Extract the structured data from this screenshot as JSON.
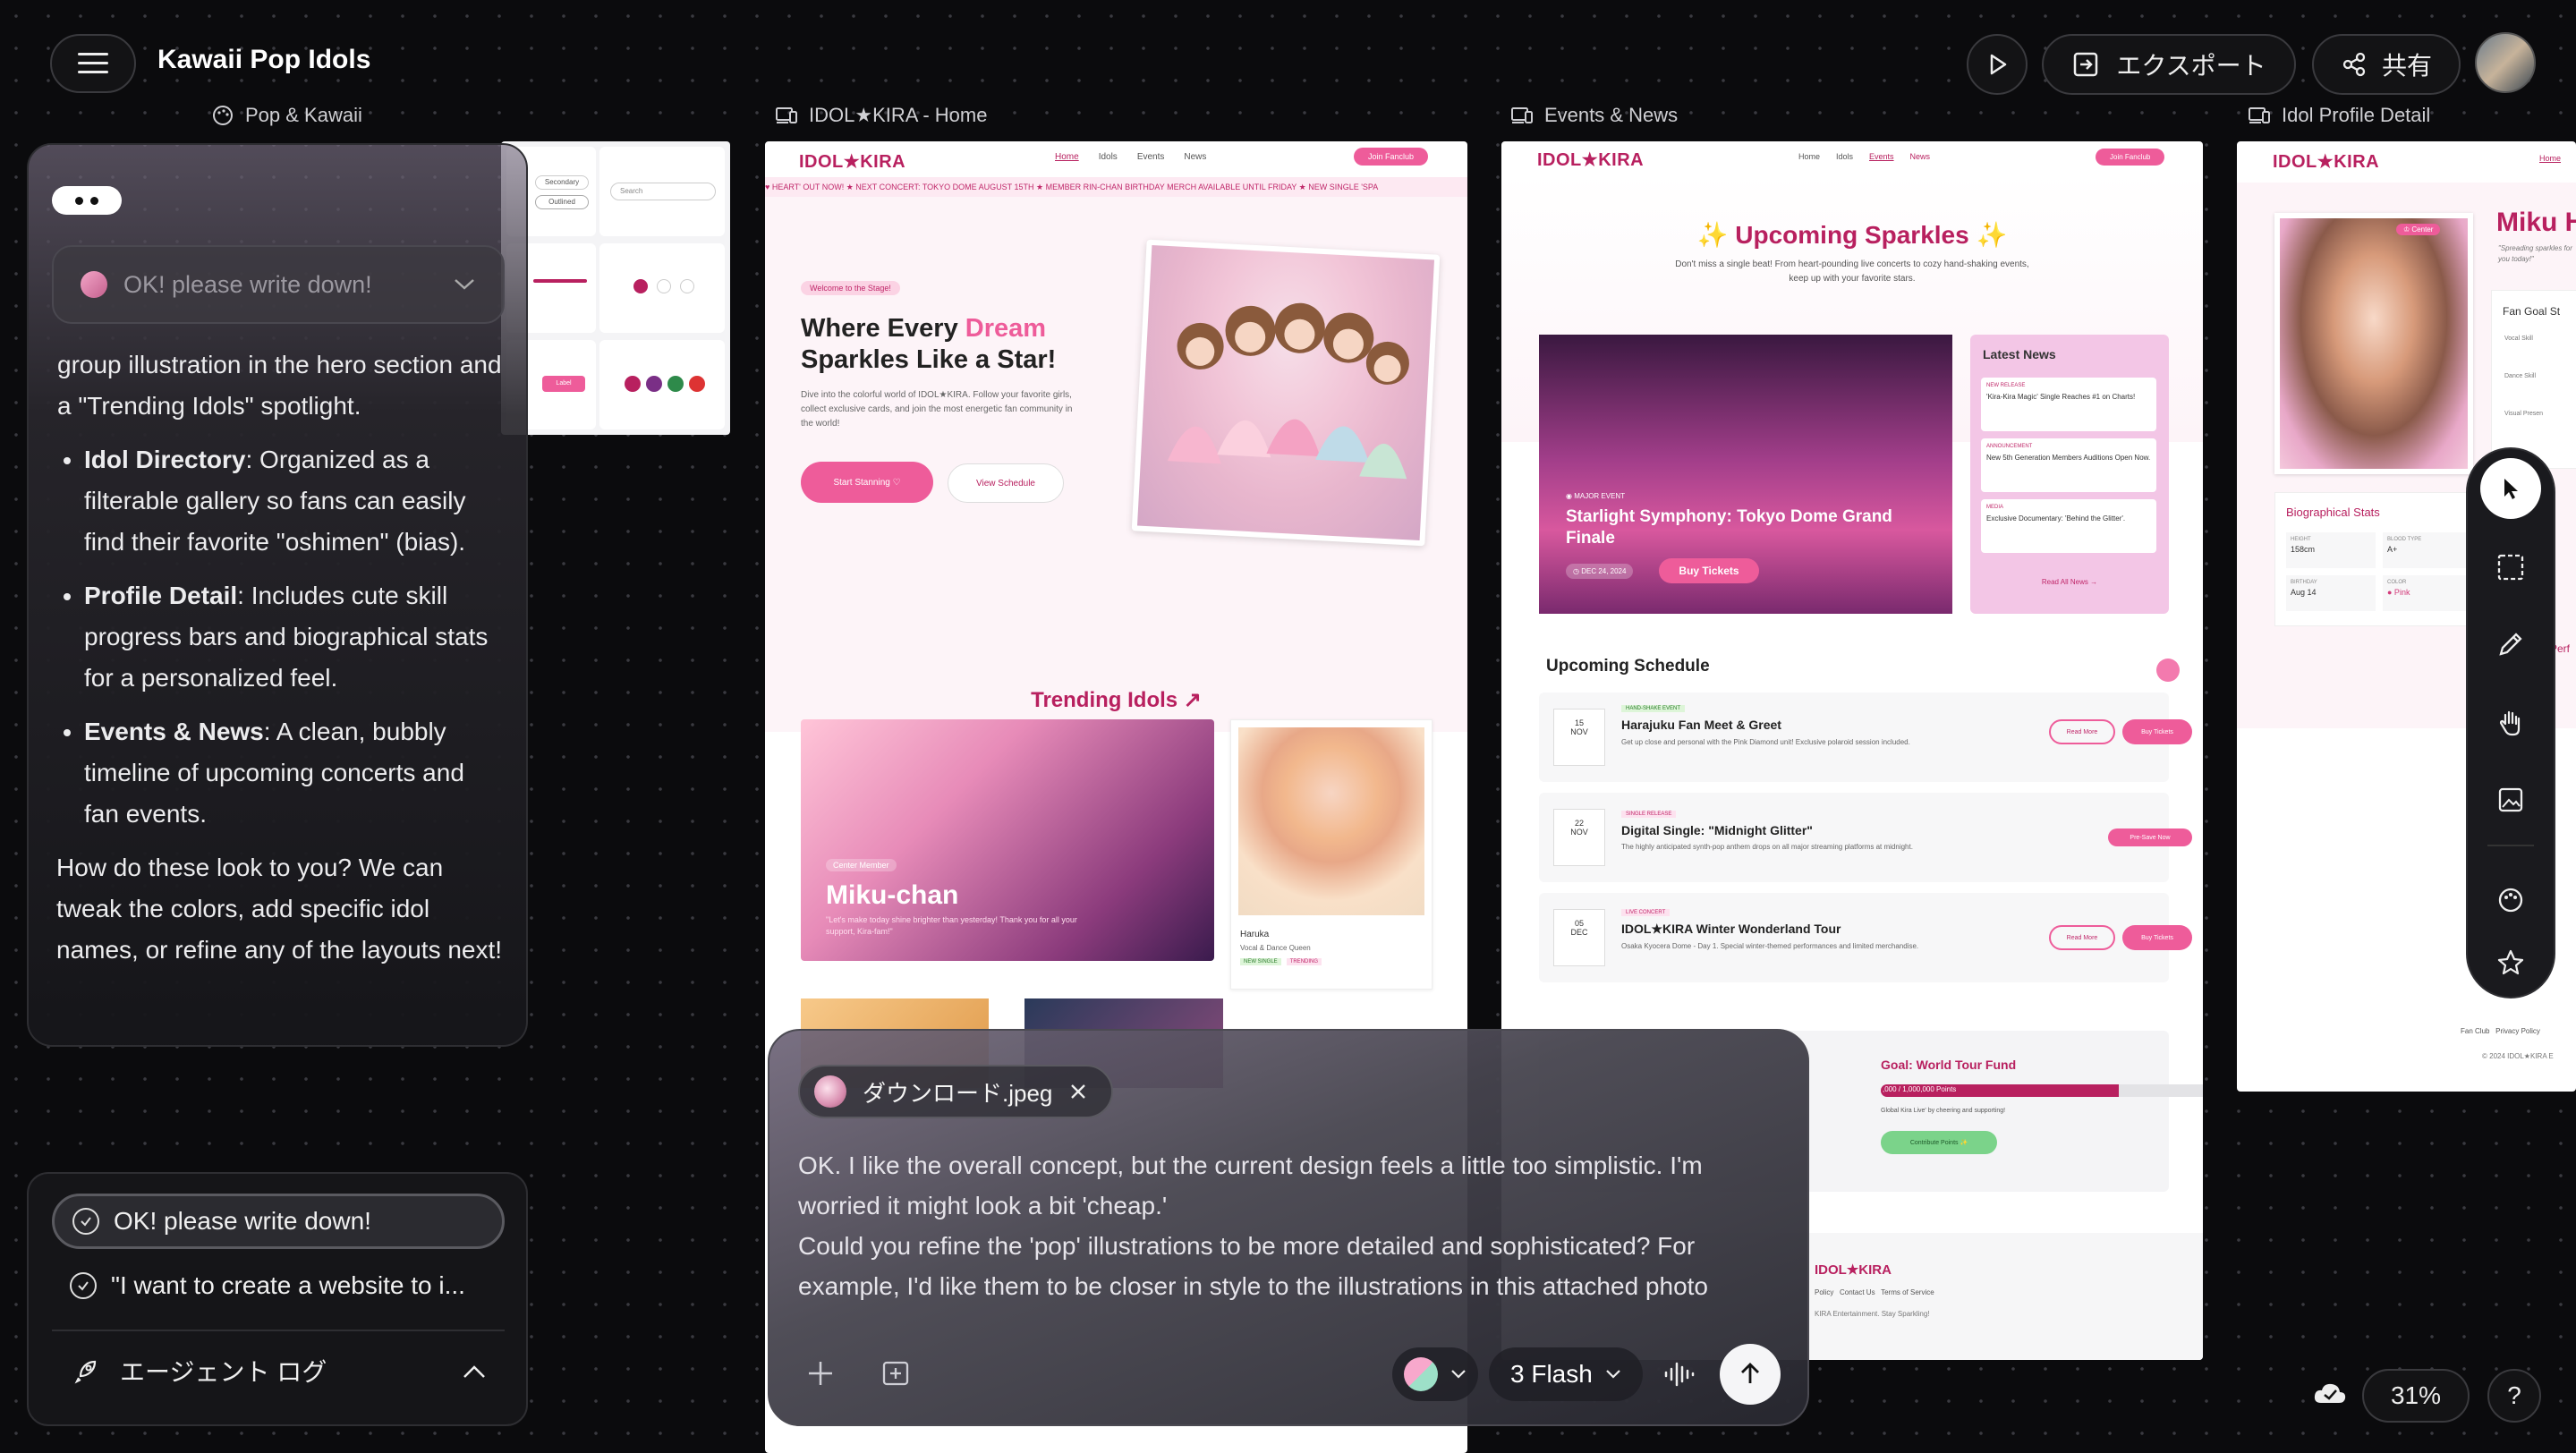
{
  "app": {
    "title": "Kawaii Pop Idols"
  },
  "topbar": {
    "export_label": "エクスポート",
    "share_label": "共有"
  },
  "frames": [
    {
      "label": "Pop & Kawaii"
    },
    {
      "label": "IDOL★KIRA - Home"
    },
    {
      "label": "Events & News"
    },
    {
      "label": "Idol Profile Detail"
    }
  ],
  "style_frame": {
    "secondary": "Secondary",
    "outlined": "Outlined",
    "search": "Search",
    "label": "Label"
  },
  "home": {
    "logo": "IDOL★KIRA",
    "nav": [
      "Home",
      "Idols",
      "Events",
      "News"
    ],
    "join": "Join Fanclub",
    "ticker": "♥ HEART' OUT NOW! ★ NEXT CONCERT: TOKYO DOME AUGUST 15TH ★ MEMBER RIN-CHAN BIRTHDAY MERCH AVAILABLE UNTIL FRIDAY ★ NEW SINGLE 'SPA",
    "welcome_badge": "Welcome to the Stage!",
    "hero_title_1": "Where Every ",
    "hero_title_em": "Dream",
    "hero_title_2": "Sparkles Like a Star!",
    "hero_desc": "Dive into the colorful world of IDOL★KIRA. Follow your favorite girls, collect exclusive cards, and join the most energetic fan community in the world!",
    "start_btn": "Start Stanning ♡",
    "schedule_btn": "View Schedule",
    "trending_title": "Trending Idols ↗",
    "card1_badge": "Center Member",
    "card1_name": "Miku-chan",
    "card1_quote": "\"Let's make today shine brighter than yesterday! Thank you for all your support, Kira-fam!\"",
    "card2_name": "Haruka",
    "card2_role": "Vocal & Dance Queen",
    "card2_tags": [
      "NEW SINGLE",
      "TRENDING"
    ]
  },
  "events": {
    "logo": "IDOL★KIRA",
    "nav": [
      "Home",
      "Idols",
      "Events",
      "News"
    ],
    "join": "Join Fanclub",
    "title": "✨ Upcoming Sparkles ✨",
    "subtitle": "Don't miss a single beat! From heart-pounding live concerts to cozy hand-shaking events, keep up with your favorite stars.",
    "major_tag": "◉ MAJOR EVENT",
    "major_title": "Starlight Symphony: Tokyo Dome Grand Finale",
    "major_date": "◷ DEC 24, 2024",
    "buy_tickets": "Buy Tickets",
    "latest_news": "Latest News",
    "news": [
      {
        "tag": "NEW RELEASE",
        "text": "'Kira-Kira Magic' Single Reaches #1 on Charts!"
      },
      {
        "tag": "ANNOUNCEMENT",
        "text": "New 5th Generation Members Auditions Open Now."
      },
      {
        "tag": "MEDIA",
        "text": "Exclusive Documentary: 'Behind the Glitter'."
      }
    ],
    "read_all": "Read All News →",
    "schedule_title": "Upcoming Schedule",
    "schedule": [
      {
        "day": "15",
        "month": "NOV",
        "tag": "HAND-SHAKE EVENT",
        "title": "Harajuku Fan Meet & Greet",
        "desc": "Get up close and personal with the Pink Diamond unit! Exclusive polaroid session included.",
        "btn1": "Read More",
        "btn2": "Buy Tickets"
      },
      {
        "day": "22",
        "month": "NOV",
        "tag": "SINGLE RELEASE",
        "title": "Digital Single: \"Midnight Glitter\"",
        "desc": "The highly anticipated synth-pop anthem drops on all major streaming platforms at midnight.",
        "btn1": "",
        "btn2": "Pre-Save Now"
      },
      {
        "day": "05",
        "month": "DEC",
        "tag": "LIVE CONCERT",
        "title": "IDOL★KIRA Winter Wonderland Tour",
        "desc": "Osaka Kyocera Dome - Day 1. Special winter-themed performances and limited merchandise.",
        "btn1": "Read More",
        "btn2": "Buy Tickets"
      }
    ],
    "goal_title": "Goal: World Tour Fund",
    "goal_progress": 0.72,
    "goal_points": ",000 / 1,000,000 Points",
    "goal_desc": "Global Kira Live' by cheering and supporting!",
    "contribute": "Contribute Points ✨",
    "footer_logo": "IDOL★KIRA",
    "footer_links": "Policy   Contact Us   Terms of Service",
    "footer_copy": "KIRA Entertainment. Stay Sparkling!"
  },
  "profile": {
    "logo": "IDOL★KIRA",
    "nav_home": "Home",
    "badge": "♔ Center",
    "name": "Miku He",
    "quote": "\"Spreading sparkles for you today!\"",
    "fan_goal": "Fan Goal St",
    "skills": [
      "Vocal Skill",
      "Dance Skill",
      "Visual Presen"
    ],
    "bio_title": "Biographical Stats",
    "stats": [
      {
        "k": "HEIGHT",
        "v": "158cm"
      },
      {
        "k": "BLOOD TYPE",
        "v": "A+"
      },
      {
        "k": "BIRTHDAY",
        "v": "Aug 14"
      },
      {
        "k": "COLOR",
        "v": "● Pink"
      }
    ],
    "perf": "Perf",
    "footer_links": "Fan Club   Privacy Policy",
    "footer_copy": "© 2024 IDOL★KIRA E"
  },
  "chat": {
    "select_text": "OK! please write down!",
    "intro": "group illustration in the hero section and a \"Trending Idols\" spotlight.",
    "bullets": [
      {
        "head": "Idol Directory",
        "text": ": Organized as a filterable gallery so fans can easily find their favorite \"oshimen\" (bias)."
      },
      {
        "head": "Profile Detail",
        "text": ": Includes cute skill progress bars and biographical stats for a personalized feel."
      },
      {
        "head": "Events & News",
        "text": ": A clean, bubbly timeline of upcoming concerts and fan events."
      }
    ],
    "outro": "How do these look to you? We can tweak the colors, add specific idol names, or refine any of the layouts next!"
  },
  "history": {
    "items": [
      "OK! please write down!",
      "\"I want to create a website to i..."
    ],
    "agent_log": "エージェント ログ"
  },
  "prompt": {
    "attachment": "ダウンロード.jpeg",
    "text": "OK. I like the overall concept, but the current design feels a little too simplistic. I'm worried it might look a bit 'cheap.'\nCould you refine the 'pop' illustrations to be more detailed and sophisticated? For example, I'd like them to be closer in style to the illustrations in this attached photo",
    "model": "3 Flash"
  },
  "zoom": "31%",
  "help": "?"
}
